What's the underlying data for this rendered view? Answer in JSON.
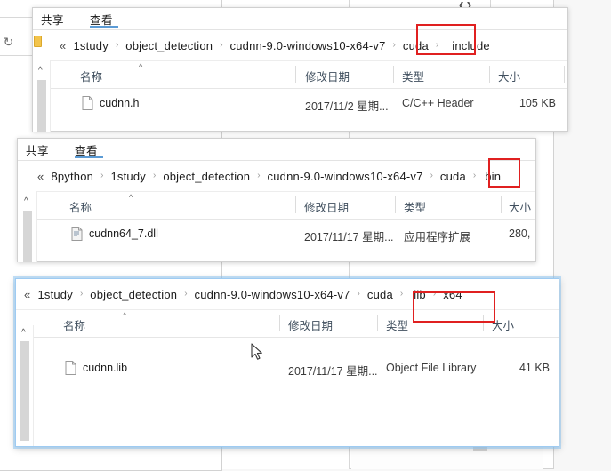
{
  "app": {
    "name": "Windows File Explorer",
    "theme_accent": "#5b9bd5",
    "annotation_color": "#e02020"
  },
  "background": {
    "desktop_color": "#f7f7f7"
  },
  "columns": {
    "name": "名称",
    "modified": "修改日期",
    "type": "类型",
    "size": "大小",
    "sort_caret": "^"
  },
  "menu": {
    "share": "共享",
    "view": "查看"
  },
  "icons": {
    "refresh": "refresh-icon",
    "back_chevrons": "«",
    "separator": "›",
    "folder": "folder-icon",
    "restore": "restore-window-icon",
    "cursor": "mouse-pointer"
  },
  "windows": [
    {
      "id": "include-window",
      "active": false,
      "menu": {
        "share": "共享",
        "view": "查看"
      },
      "breadcrumb": {
        "back": "«",
        "parts": [
          "1study",
          "object_detection",
          "cudnn-9.0-windows10-x64-v7",
          "cuda",
          "include"
        ],
        "highlighted": "include"
      },
      "files": [
        {
          "name": "cudnn.h",
          "icon": "header-file-icon",
          "modified": "2017/11/2 星期...",
          "type": "C/C++ Header",
          "size": "105 KB"
        }
      ]
    },
    {
      "id": "bin-window",
      "active": false,
      "menu": {
        "share": "共享",
        "view": "查看"
      },
      "breadcrumb": {
        "back": "«",
        "parts": [
          "8python",
          "1study",
          "object_detection",
          "cudnn-9.0-windows10-x64-v7",
          "cuda",
          "bin"
        ],
        "highlighted": "bin"
      },
      "files": [
        {
          "name": "cudnn64_7.dll",
          "icon": "dll-file-icon",
          "modified": "2017/11/17 星期...",
          "type": "应用程序扩展",
          "size": "280,"
        }
      ]
    },
    {
      "id": "lib-x64-window",
      "active": true,
      "menu": {
        "share": "共享",
        "view": "查看"
      },
      "breadcrumb": {
        "back": "«",
        "parts": [
          "1study",
          "object_detection",
          "cudnn-9.0-windows10-x64-v7",
          "cuda",
          "lib",
          "x64"
        ],
        "highlighted": "lib › x64"
      },
      "files": [
        {
          "name": "cudnn.lib",
          "icon": "lib-file-icon",
          "modified": "2017/11/17 星期...",
          "type": "Object File Library",
          "size": "41 KB"
        }
      ]
    }
  ]
}
